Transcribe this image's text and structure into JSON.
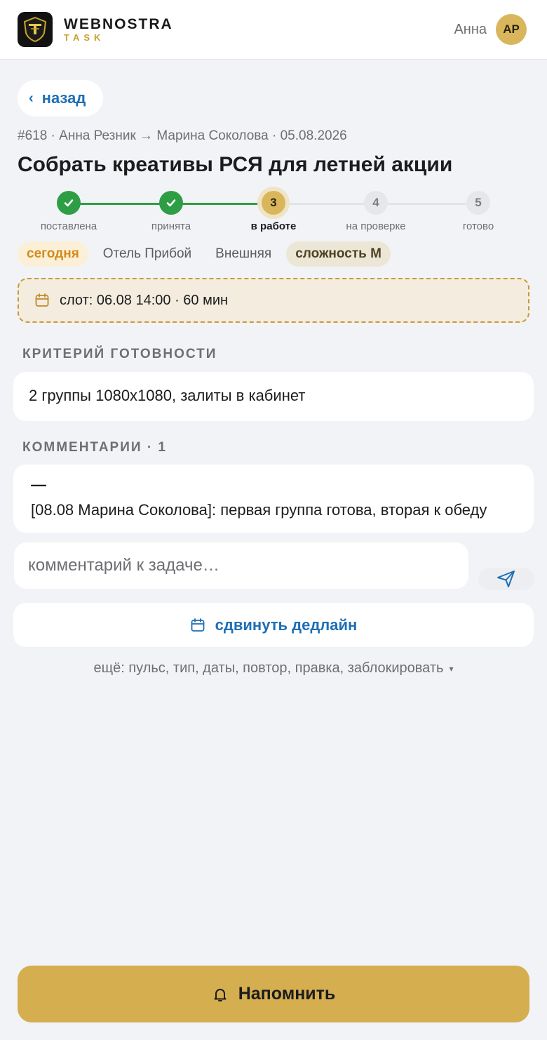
{
  "header": {
    "brand_name": "WEBNOSTRA",
    "brand_sub": "TASK",
    "user_name": "Анна",
    "avatar_initials": "АР"
  },
  "nav": {
    "back_label": "назад"
  },
  "task": {
    "meta": "#618 · Анна Резник → Марина Соколова · 05.08.2026",
    "title": "Собрать креативы РСЯ для летней акции"
  },
  "steps": [
    {
      "number": "1",
      "label": "поставлена",
      "state": "done"
    },
    {
      "number": "2",
      "label": "принята",
      "state": "done"
    },
    {
      "number": "3",
      "label": "в работе",
      "state": "current"
    },
    {
      "number": "4",
      "label": "на проверке",
      "state": "todo"
    },
    {
      "number": "5",
      "label": "готово",
      "state": "todo"
    }
  ],
  "chips": {
    "today": "сегодня",
    "hotel": "Отель Прибой",
    "scope": "Внешняя",
    "complexity": "сложность М"
  },
  "slot": {
    "text": "слот: 06.08 14:00 · 60 мин"
  },
  "criteria": {
    "title": "КРИТЕРИЙ ГОТОВНОСТИ",
    "text": "2 группы 1080x1080, залиты в кабинет"
  },
  "comments": {
    "title": "КОММЕНТАРИИ · 1",
    "dash": "—",
    "items": [
      "[08.08 Марина Соколова]: первая группа готова, вторая к обеду"
    ],
    "input_placeholder": "комментарий к задаче…"
  },
  "actions": {
    "deadline_label": "сдвинуть дедлайн",
    "more_label": "ещё: пульс, тип, даты, повтор, правка, заблокировать",
    "more_arrow": "▾",
    "remind_label": "Напомнить"
  },
  "colors": {
    "accent_blue": "#1f6fb5",
    "gold": "#d4ae4f",
    "done_green": "#2e9e44",
    "today_orange": "#d38a1a"
  },
  "icons": [
    "check-icon",
    "calendar-icon",
    "send-icon",
    "bell-icon",
    "chevron-left-icon"
  ]
}
